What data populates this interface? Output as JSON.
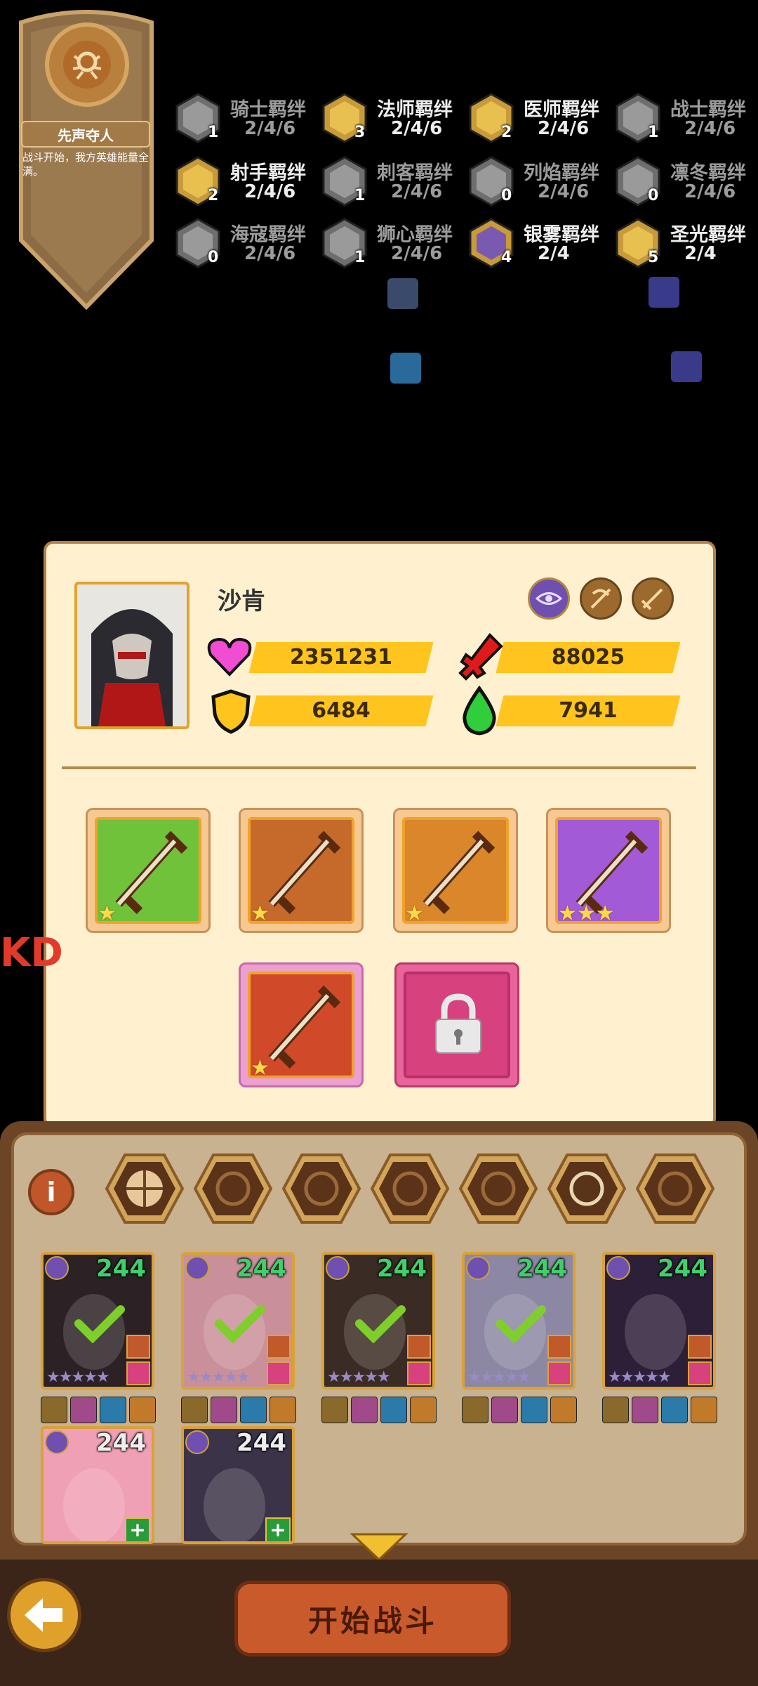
{
  "talent": {
    "title": "先声夺人",
    "desc": "战斗开始，我方英雄能量全满。",
    "icon": "spider-emblem-icon"
  },
  "bonds": [
    {
      "name": "骑士羁绊",
      "tiers": "2/4/6",
      "count": "1",
      "state": "dim",
      "icon": "knight-icon"
    },
    {
      "name": "法师羁绊",
      "tiers": "2/4/6",
      "count": "3",
      "state": "lit",
      "icon": "mage-icon"
    },
    {
      "name": "医师羁绊",
      "tiers": "2/4/6",
      "count": "2",
      "state": "lit",
      "icon": "cross-icon"
    },
    {
      "name": "战士羁绊",
      "tiers": "2/4/6",
      "count": "1",
      "state": "dim",
      "icon": "axe-icon"
    },
    {
      "name": "射手羁绊",
      "tiers": "2/4/6",
      "count": "2",
      "state": "lit",
      "icon": "crossbow-icon"
    },
    {
      "name": "刺客羁绊",
      "tiers": "2/4/6",
      "count": "1",
      "state": "dim",
      "icon": "claw-icon"
    },
    {
      "name": "列焰羁绊",
      "tiers": "2/4/6",
      "count": "0",
      "state": "dim",
      "icon": "flame-icon"
    },
    {
      "name": "凛冬羁绊",
      "tiers": "2/4/6",
      "count": "0",
      "state": "dim",
      "icon": "snowflake-icon"
    },
    {
      "name": "海寇羁绊",
      "tiers": "2/4/6",
      "count": "0",
      "state": "dim",
      "icon": "wave-icon"
    },
    {
      "name": "狮心羁绊",
      "tiers": "2/4/6",
      "count": "1",
      "state": "dim",
      "icon": "leaf-icon"
    },
    {
      "name": "银雾羁绊",
      "tiers": "2/4",
      "count": "4",
      "state": "lit",
      "icon": "eye-icon"
    },
    {
      "name": "圣光羁绊",
      "tiers": "2/4",
      "count": "5",
      "state": "lit",
      "icon": "swirl-icon"
    }
  ],
  "hero": {
    "name": "沙肯",
    "hp": "2351231",
    "atk": "88025",
    "def": "6484",
    "energy": "7941",
    "tags": [
      "eye-icon",
      "crossbow-icon",
      "sword-icon"
    ]
  },
  "equipment": [
    {
      "name": "poison-dagger",
      "stars": "★",
      "bg": "#6fc23a"
    },
    {
      "name": "leather-cloak",
      "stars": "★",
      "bg": "#c56a2a"
    },
    {
      "name": "golden-blade",
      "stars": "★",
      "bg": "#d9872a"
    },
    {
      "name": "purple-goggles",
      "stars": "★★★",
      "bg": "#a25ad6"
    },
    {
      "name": "crossbow-item",
      "stars": "★",
      "bg": "#d04a2a"
    }
  ],
  "filters": [
    "all-filter",
    "fire-filter",
    "ice-filter",
    "wave-filter",
    "leaf-filter",
    "eye-filter",
    "swirl-filter"
  ],
  "roster": [
    {
      "level": "244",
      "color": "green",
      "selected": true,
      "bg": "#2c2226"
    },
    {
      "level": "244",
      "color": "green",
      "selected": true,
      "bg": "#c9909a"
    },
    {
      "level": "244",
      "color": "green",
      "selected": true,
      "bg": "#3a2c24"
    },
    {
      "level": "244",
      "color": "green",
      "selected": true,
      "bg": "#8c88a4"
    },
    {
      "level": "244",
      "color": "green",
      "selected": false,
      "bg": "#2c1f38"
    },
    {
      "level": "244",
      "color": "white",
      "selected": false,
      "bg": "#f0a0b4"
    },
    {
      "level": "244",
      "color": "white",
      "selected": false,
      "bg": "#3b3448"
    }
  ],
  "start_label": "开始战斗",
  "colors": {
    "panel": "#fff1cf",
    "bar": "#ffc51e",
    "accent": "#d9a23a"
  }
}
